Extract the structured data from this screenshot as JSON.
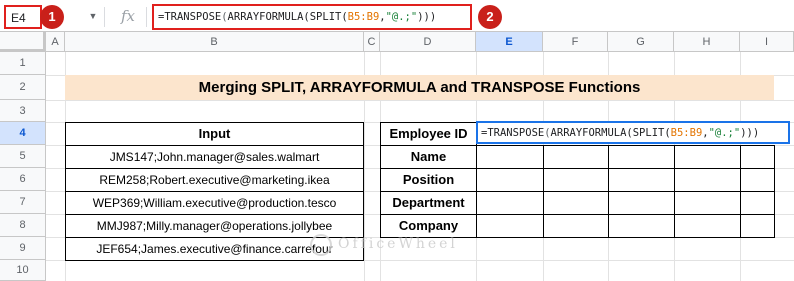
{
  "formula_bar": {
    "name_box": "E4",
    "fx_label": "fx",
    "formula_parts": {
      "p1": "=TRANSPOSE",
      "p2": "(",
      "p3": "ARRAYFORMULA(SPLIT(",
      "ref": "B5:B9",
      "p4": ",",
      "str": "\"@.;\"",
      "p5": ")))"
    },
    "badge1": "1",
    "badge2": "2"
  },
  "columns": [
    "A",
    "B",
    "C",
    "D",
    "E",
    "F",
    "G",
    "H",
    "I"
  ],
  "rows": [
    "1",
    "2",
    "3",
    "4",
    "5",
    "6",
    "7",
    "8",
    "9",
    "10"
  ],
  "selected_column": "E",
  "selected_row": "4",
  "title": "Merging SPLIT, ARRAYFORMULA and TRANSPOSE Functions",
  "input_table": {
    "header": "Input",
    "rows": [
      "JMS147;John.manager@sales.walmart",
      "REM258;Robert.executive@marketing.ikea",
      "WEP369;William.executive@production.tesco",
      "MMJ987;Milly.manager@operations.jollybee",
      "JEF654;James.executive@finance.carrefour"
    ]
  },
  "output_table": {
    "labels": [
      "Employee ID",
      "Name",
      "Position",
      "Department",
      "Company"
    ],
    "active_cell_formula": {
      "p1": "=TRANSPOSE",
      "p2": "(",
      "p3": "ARRAYFORMULA(SPLIT(",
      "ref": "B5:B9",
      "p4": ",",
      "str": "\"@.;\"",
      "p5": ")))"
    }
  },
  "watermark": "OfficeWheel",
  "colors": {
    "title_fill": "#fce5cd",
    "selection_blue": "#1a73e8",
    "callout_red": "#e0201d",
    "range_ref": "#e37400",
    "string_green": "#188038"
  }
}
